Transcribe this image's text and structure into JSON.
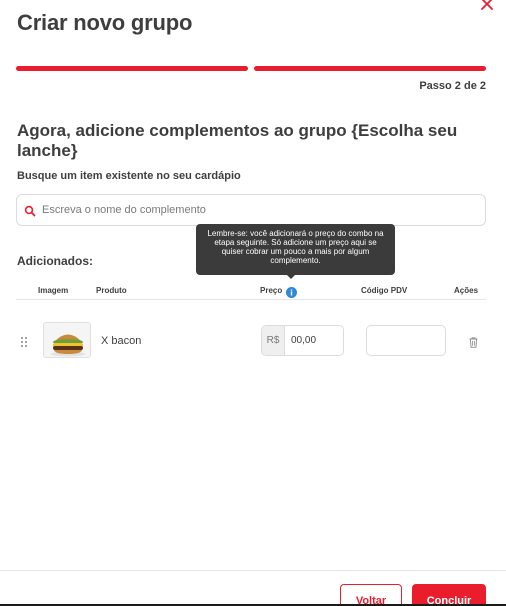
{
  "modal": {
    "title": "Criar novo grupo",
    "step": "Passo 2 de 2",
    "subtitle": "Agora, adicione complementos ao grupo {Escolha seu lanche}"
  },
  "search": {
    "label": "Busque um item existente no seu cardápio",
    "placeholder": "Escreva o nome do complemento"
  },
  "added": {
    "label": "Adicionados:"
  },
  "table": {
    "headers": {
      "image": "Imagem",
      "product": "Produto",
      "price": "Preço",
      "pdv": "Código PDV",
      "actions": "Ações"
    },
    "rows": [
      {
        "product": "X bacon",
        "currency": "R$",
        "price": "00,00",
        "pdv": ""
      }
    ]
  },
  "tooltip": {
    "text": "Lembre-se: você adicionará o preço do combo na etapa seguinte. Só adicione um preço aqui se quiser cobrar um pouco a mais por algum complemento."
  },
  "footer": {
    "back_label": "Voltar",
    "finish_label": "Concluir"
  },
  "colors": {
    "accent": "#ea1d2c",
    "text": "#3e3e3e",
    "info": "#2e89d6",
    "tooltip_bg": "#3b3b3b"
  },
  "icons": {
    "close": "close-icon",
    "search": "search-icon",
    "info": "info-icon",
    "drag": "drag-handle-icon",
    "delete": "trash-icon"
  }
}
